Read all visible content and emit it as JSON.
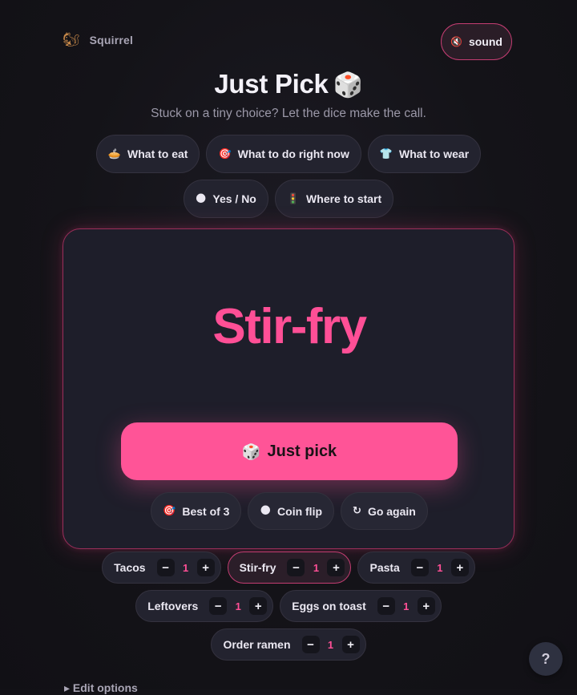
{
  "app": {
    "name": "Squirrel",
    "logo_icon": "🐿"
  },
  "sound": {
    "icon": "🔇",
    "label": "sound"
  },
  "header": {
    "title": "Just Pick",
    "title_icon": "🎲",
    "subtitle": "Stuck on a tiny choice? Let the dice make the call."
  },
  "categories": [
    {
      "icon": "🥧",
      "label": "What to eat"
    },
    {
      "icon": "🎯",
      "label": "What to do right now"
    },
    {
      "icon": "👕",
      "label": "What to wear"
    },
    {
      "icon": "🌑",
      "label": "Yes / No"
    },
    {
      "icon": "🚦",
      "label": "Where to start"
    }
  ],
  "result": {
    "text": "Stir-fry"
  },
  "pick_button": {
    "icon": "🎲",
    "label": "Just pick"
  },
  "actions": [
    {
      "icon": "🎯",
      "label": "Best of 3"
    },
    {
      "icon": "🌑",
      "label": "Coin flip"
    },
    {
      "icon": "↻",
      "label": "Go again"
    }
  ],
  "options": [
    {
      "label": "Tacos",
      "count": "1",
      "active": false
    },
    {
      "label": "Stir-fry",
      "count": "1",
      "active": true
    },
    {
      "label": "Pasta",
      "count": "1",
      "active": false
    },
    {
      "label": "Leftovers",
      "count": "1",
      "active": false
    },
    {
      "label": "Eggs on toast",
      "count": "1",
      "active": false
    },
    {
      "label": "Order ramen",
      "count": "1",
      "active": false
    }
  ],
  "stepper": {
    "minus": "−",
    "plus": "+"
  },
  "edit_options": {
    "label": "▸ Edit options"
  },
  "help": {
    "label": "?"
  },
  "colors": {
    "accent": "#ff5497",
    "background": "#141318",
    "card": "#1e1e2a"
  }
}
